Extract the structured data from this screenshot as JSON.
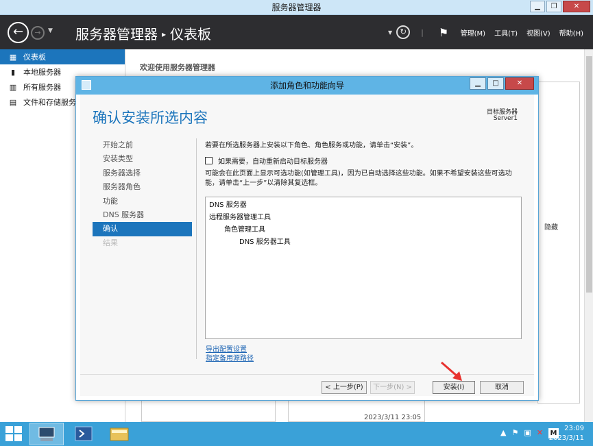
{
  "window": {
    "title": "服务器管理器"
  },
  "header": {
    "breadcrumb_root": "服务器管理器",
    "breadcrumb_page": "仪表板",
    "menus": [
      "管理(M)",
      "工具(T)",
      "视图(V)",
      "帮助(H)"
    ]
  },
  "sidebar": {
    "items": [
      {
        "label": "仪表板",
        "icon": "dashboard-icon"
      },
      {
        "label": "本地服务器",
        "icon": "server-icon"
      },
      {
        "label": "所有服务器",
        "icon": "servers-icon"
      },
      {
        "label": "文件和存储服务",
        "icon": "storage-icon"
      }
    ]
  },
  "content": {
    "welcome": "欢迎使用服务器管理器",
    "hide": "隐藏",
    "timestamp": "2023/3/11 23:05"
  },
  "wizard": {
    "title": "添加角色和功能向导",
    "heading": "确认安装所选内容",
    "target_label": "目标服务器",
    "target_server": "Server1",
    "steps": [
      "开始之前",
      "安装类型",
      "服务器选择",
      "服务器角色",
      "功能",
      "DNS 服务器",
      "确认",
      "结果"
    ],
    "active_step": "确认",
    "description": "若要在所选服务器上安装以下角色、角色服务或功能，请单击“安装”。",
    "restart_checkbox": "如果需要，自动重新启动目标服务器",
    "restart_checked": false,
    "note": "可能会在此页面上显示可选功能(如管理工具)，因为已自动选择这些功能。如果不希望安装这些可选功能，请单击“上一步”以清除其复选框。",
    "selections": [
      {
        "label": "DNS 服务器",
        "level": 0
      },
      {
        "label": "远程服务器管理工具",
        "level": 0
      },
      {
        "label": "角色管理工具",
        "level": 1
      },
      {
        "label": "DNS 服务器工具",
        "level": 2
      }
    ],
    "links": {
      "export": "导出配置设置",
      "alt_source": "指定备用源路径"
    },
    "buttons": {
      "prev": "< 上一步(P)",
      "next": "下一步(N) >",
      "install": "安装(I)",
      "cancel": "取消"
    }
  },
  "taskbar": {
    "ime": "M",
    "time": "23:09",
    "date": "2023/3/11"
  }
}
